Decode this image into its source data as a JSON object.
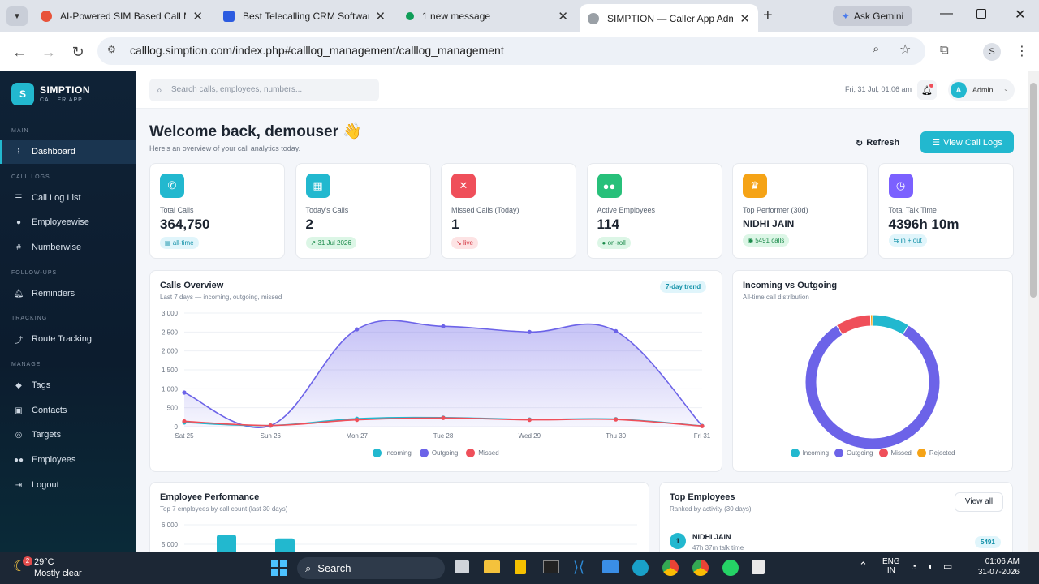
{
  "browser": {
    "tabs": [
      {
        "title": "AI-Powered SIM Based Call Manag",
        "color": "#e8533a"
      },
      {
        "title": "Best Telecalling CRM Software To",
        "color": "#2c5be0"
      },
      {
        "title": "1 new message",
        "color": "#0f9d58"
      },
      {
        "title": "SIMPTION — Caller App Admin",
        "color": "#5f6368"
      }
    ],
    "gemini": "Ask Gemini",
    "url": "calllog.simption.com/index.php#calllog_management/calllog_management",
    "profile": "S"
  },
  "sidebar": {
    "brand": "SIMPTION",
    "tagline": "CALLER APP",
    "logo": "S",
    "sections": {
      "main": "MAIN",
      "call_logs": "CALL LOGS",
      "follow_ups": "FOLLOW-UPS",
      "tracking": "TRACKING",
      "manage": "MANAGE"
    },
    "items": {
      "dashboard": "Dashboard",
      "call_log_list": "Call Log List",
      "employeewise": "Employeewise",
      "numberwise": "Numberwise",
      "reminders": "Reminders",
      "route_tracking": "Route Tracking",
      "tags": "Tags",
      "contacts": "Contacts",
      "targets": "Targets",
      "employees": "Employees",
      "logout": "Logout"
    }
  },
  "topbar": {
    "search_placeholder": "Search calls, employees, numbers...",
    "datetime": "Fri, 31 Jul, 01:06 am",
    "avatar": "A",
    "user": "Admin"
  },
  "header": {
    "title": "Welcome back, demouser 👋",
    "subtitle": "Here's an overview of your call analytics today.",
    "refresh": "Refresh",
    "view_logs": "View Call Logs"
  },
  "stats": [
    {
      "label": "Total Calls",
      "value": "364,750",
      "pill": "all-time",
      "color": "#22b8cf",
      "pill_bg": "#e0f5fb",
      "pill_fg": "#1391a8"
    },
    {
      "label": "Today's Calls",
      "value": "2",
      "pill": "31 Jul 2026",
      "color": "#22b8cf",
      "pill_bg": "#dcf6e6",
      "pill_fg": "#1b8a4a"
    },
    {
      "label": "Missed Calls (Today)",
      "value": "1",
      "pill": "live",
      "color": "#ef4f5a",
      "pill_bg": "#fde3e4",
      "pill_fg": "#d2323e"
    },
    {
      "label": "Active Employees",
      "value": "114",
      "pill": "on-roll",
      "color": "#27c07a",
      "pill_bg": "#dcf6e6",
      "pill_fg": "#1b8a4a"
    },
    {
      "label": "Top Performer (30d)",
      "value": "NIDHI JAIN",
      "pill": "5491 calls",
      "color": "#f5a316",
      "pill_bg": "#dcf6e6",
      "pill_fg": "#1b8a4a"
    },
    {
      "label": "Total Talk Time",
      "value": "4396h 10m",
      "pill": "in + out",
      "color": "#7b61ff",
      "pill_bg": "#e0f5fb",
      "pill_fg": "#1391a8"
    }
  ],
  "calls_overview": {
    "title": "Calls Overview",
    "subtitle": "Last 7 days — incoming, outgoing, missed",
    "badge": "7-day trend"
  },
  "donut_card": {
    "title": "Incoming vs Outgoing",
    "subtitle": "All-time call distribution"
  },
  "perf_card": {
    "title": "Employee Performance",
    "subtitle": "Top 7 employees by call count (last 30 days)"
  },
  "top_emp": {
    "title": "Top Employees",
    "subtitle": "Ranked by activity (30 days)",
    "view_all": "View all",
    "rows": [
      {
        "rank": "1",
        "name": "NIDHI JAIN",
        "meta": "47h 37m talk time",
        "count": "5491"
      }
    ]
  },
  "chart_data": [
    {
      "type": "area",
      "title": "Calls Overview",
      "categories": [
        "Sat 25",
        "Sun 26",
        "Mon 27",
        "Tue 28",
        "Wed 29",
        "Thu 30",
        "Fri 31"
      ],
      "ylim": [
        0,
        3000
      ],
      "yticks": [
        "0",
        "500",
        "1,000",
        "1,500",
        "2,000",
        "2,500",
        "3,000"
      ],
      "series": [
        {
          "name": "Incoming",
          "color": "#22b8cf",
          "values": [
            110,
            30,
            210,
            240,
            190,
            200,
            20
          ]
        },
        {
          "name": "Outgoing",
          "color": "#6c63e8",
          "values": [
            900,
            30,
            2570,
            2650,
            2500,
            2520,
            20
          ]
        },
        {
          "name": "Missed",
          "color": "#ef4f5a",
          "values": [
            140,
            30,
            180,
            230,
            180,
            190,
            15
          ]
        }
      ],
      "legend": "bottom"
    },
    {
      "type": "pie",
      "title": "Incoming vs Outgoing",
      "series": [
        {
          "name": "Incoming",
          "color": "#22b8cf",
          "value": 9
        },
        {
          "name": "Outgoing",
          "color": "#6c63e8",
          "value": 82
        },
        {
          "name": "Missed",
          "color": "#ef4f5a",
          "value": 8.5
        },
        {
          "name": "Rejected",
          "color": "#f5a316",
          "value": 0.5
        }
      ],
      "legend": "bottom"
    },
    {
      "type": "bar",
      "title": "Employee Performance",
      "ylim": [
        0,
        6000
      ],
      "yticks": [
        "5,000",
        "6,000"
      ],
      "color": "#22b8cf",
      "values": [
        5491,
        5300
      ]
    }
  ],
  "taskbar": {
    "temp": "29°C",
    "weather": "Mostly clear",
    "weather_badge": "2",
    "search": "Search",
    "lang1": "ENG",
    "lang2": "IN",
    "time": "01:06 AM",
    "date": "31-07-2026"
  }
}
